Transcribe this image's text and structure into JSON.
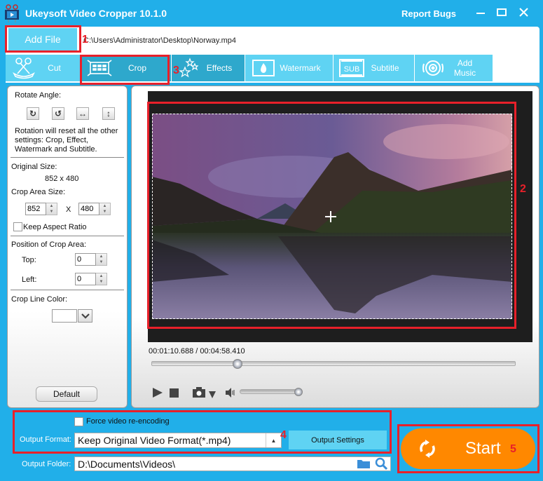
{
  "window": {
    "title": "Ukeysoft Video Cropper 10.1.0",
    "report_bugs": "Report Bugs",
    "controls": [
      "minimize-icon",
      "maximize-icon",
      "close-icon"
    ]
  },
  "file": {
    "add_file_label": "Add File",
    "path": "C:\\Users\\Administrator\\Desktop\\Norway.mp4"
  },
  "tabs": [
    {
      "label": "Cut",
      "icon": "scissors-icon",
      "active": false
    },
    {
      "label": "Crop",
      "icon": "crop-icon",
      "active": true
    },
    {
      "label": "Effects",
      "icon": "stars-icon",
      "active": true
    },
    {
      "label": "Watermark",
      "icon": "watermark-icon",
      "active": false
    },
    {
      "label": "Subtitle",
      "icon": "subtitle-icon",
      "active": false
    },
    {
      "label": "Add Music",
      "icon": "music-icon",
      "active": false
    }
  ],
  "left_panel": {
    "rotate_label": "Rotate Angle:",
    "rotate_buttons": [
      "rotate-right-icon",
      "rotate-left-icon",
      "flip-horizontal-icon",
      "flip-vertical-icon"
    ],
    "rotation_note_1": "Rotation will reset all the other",
    "rotation_note_2": "settings: Crop, Effect,",
    "rotation_note_3": "Watermark and Subtitle.",
    "original_size_label": "Original Size:",
    "original_size_value": "852 x 480",
    "crop_area_label": "Crop Area Size:",
    "crop_width": "852",
    "crop_x": "X",
    "crop_height": "480",
    "keep_aspect_label": "Keep Aspect Ratio",
    "keep_aspect_checked": false,
    "position_label": "Position of Crop Area:",
    "top_label": "Top:",
    "top_value": "0",
    "left_label": "Left:",
    "left_value": "0",
    "line_color_label": "Crop Line Color:",
    "line_color": "#ffffff",
    "default_label": "Default"
  },
  "player": {
    "time_readout": "00:01:10.688 / 00:04:58.410",
    "seek_fraction": 0.236,
    "volume_fraction": 1.0,
    "controls": [
      "play-icon",
      "stop-icon",
      "camera-icon",
      "camera-dropdown-icon",
      "volume-icon"
    ]
  },
  "output": {
    "force_reencode_label": "Force video re-encoding",
    "force_reencode_checked": false,
    "format_label": "Output Format:",
    "format_value": "Keep Original Video Format(*.mp4)",
    "output_settings_label": "Output Settings",
    "folder_label": "Output Folder:",
    "folder_value": "D:\\Documents\\Videos\\",
    "start_label": "Start"
  },
  "annotations": {
    "n1": "1",
    "n2": "2",
    "n3": "3",
    "n4": "4",
    "n5": "5"
  },
  "colors": {
    "brand": "#21afe9",
    "tab": "#5fd3f3",
    "tab_active": "#2ea8cc",
    "start": "#ff8800",
    "annotation": "#e8202a"
  }
}
